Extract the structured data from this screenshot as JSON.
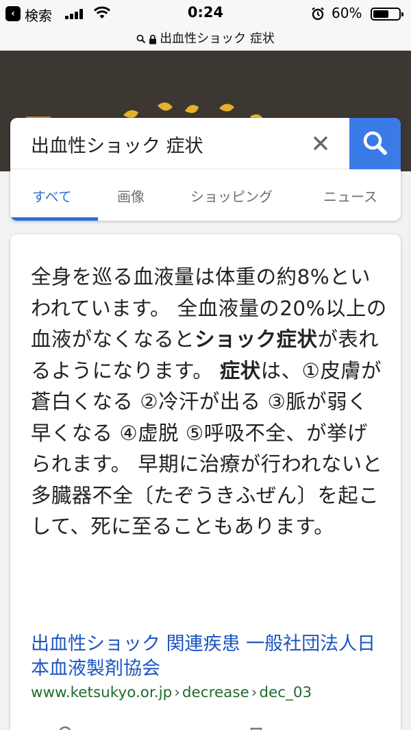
{
  "status_bar": {
    "back_label": "検索",
    "time": "0:24",
    "battery_pct": "60%",
    "battery_level": 0.6
  },
  "url_bar": {
    "title": "出血性ショック 症状"
  },
  "search": {
    "query": "出血性ショック 症状"
  },
  "tabs": [
    {
      "label": "すべて",
      "active": true
    },
    {
      "label": "画像",
      "active": false
    },
    {
      "label": "ショッピング",
      "active": false
    },
    {
      "label": "ニュース",
      "active": false
    }
  ],
  "result": {
    "snippet": {
      "part1": "全身を巡る血液量は体重の約8%といわれています。 全血液量の20%以上の血液がなくなると",
      "bold1": "ショック症状",
      "part2": "が表れるようになります。 ",
      "bold2": "症状",
      "part3": "は、①皮膚が蒼白くなる ②冷汗が出る ③脈が弱く早くなる ④虚脱 ⑤呼吸不全、が挙げられます。 早期に治療が行われないと多臓器不全〔たぞうきふぜん〕を起こして、死に至ることもあります。"
    },
    "title": "出血性ショック 関連疾患 一般社団法人日本血液製剤協会",
    "url_domain": "www.ketsukyo.or.jp",
    "url_path1": "decrease",
    "url_path2": "dec_03",
    "url_sep": "›"
  },
  "colors": {
    "accent_blue": "#3b7be8",
    "link_blue": "#1a55c0",
    "url_green": "#1e6b2d",
    "menu_orange": "#d9813c",
    "doodle_bg": "#3c3731"
  }
}
